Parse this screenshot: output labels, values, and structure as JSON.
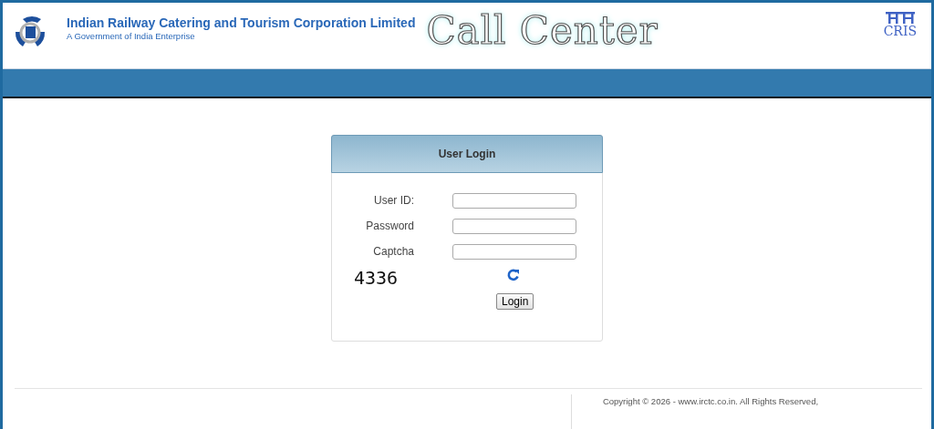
{
  "header": {
    "org_name": "Indian Railway Catering and Tourism Corporation Limited",
    "org_subtitle": "A Government of India Enterprise",
    "title": "Call Center",
    "partner_logo_text": "CRIS"
  },
  "login_panel": {
    "title": "User Login",
    "fields": [
      {
        "label": "User ID:"
      },
      {
        "label": "Password"
      },
      {
        "label": "Captcha"
      }
    ],
    "captcha_code": "4336",
    "submit_button": "Login"
  },
  "footer": {
    "copyright": "Copyright © 2026 - www.irctc.co.in. All Rights Reserved,"
  }
}
